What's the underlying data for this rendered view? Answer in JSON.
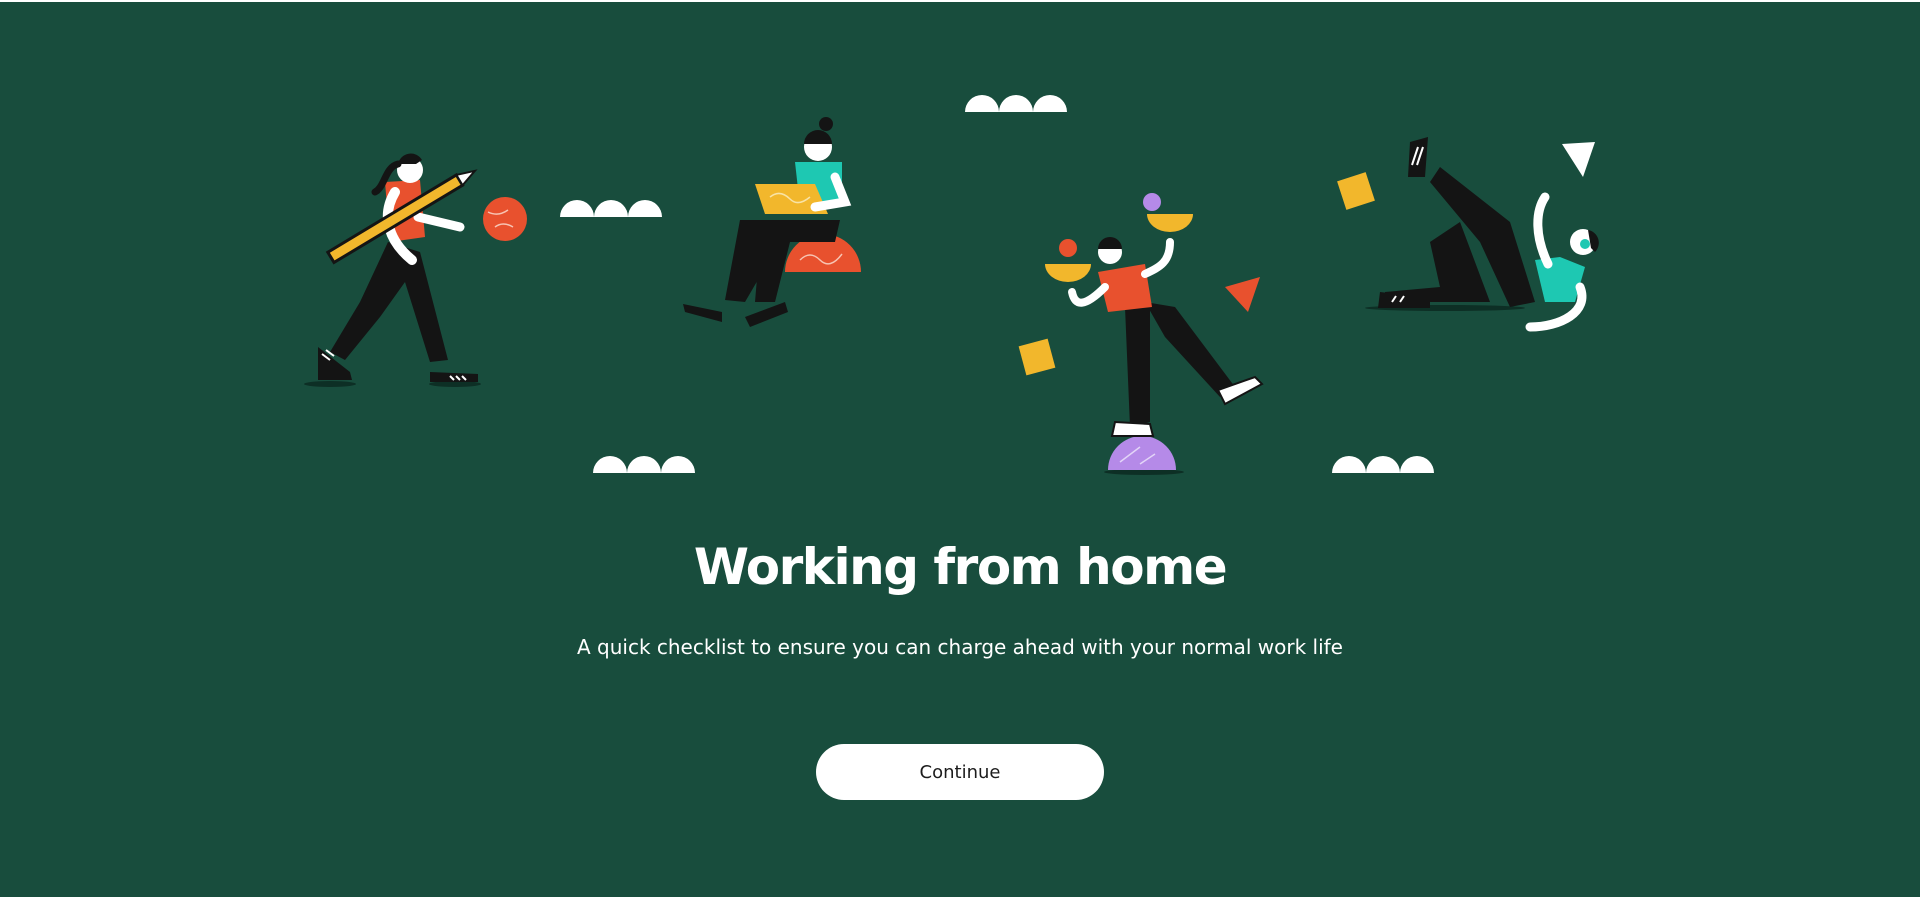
{
  "hero": {
    "title": "Working from home",
    "subtitle": "A quick checklist to ensure you can charge ahead with your normal work life"
  },
  "actions": {
    "continue_label": "Continue"
  },
  "colors": {
    "background": "#184d3d",
    "button_background": "#ffffff",
    "text": "#ffffff",
    "accent_orange": "#e8512e",
    "accent_yellow": "#f2b72c",
    "accent_teal": "#1ec8b2",
    "accent_purple": "#b58ae8"
  },
  "illustration": {
    "scene": "people-working-from-home-illustration"
  }
}
